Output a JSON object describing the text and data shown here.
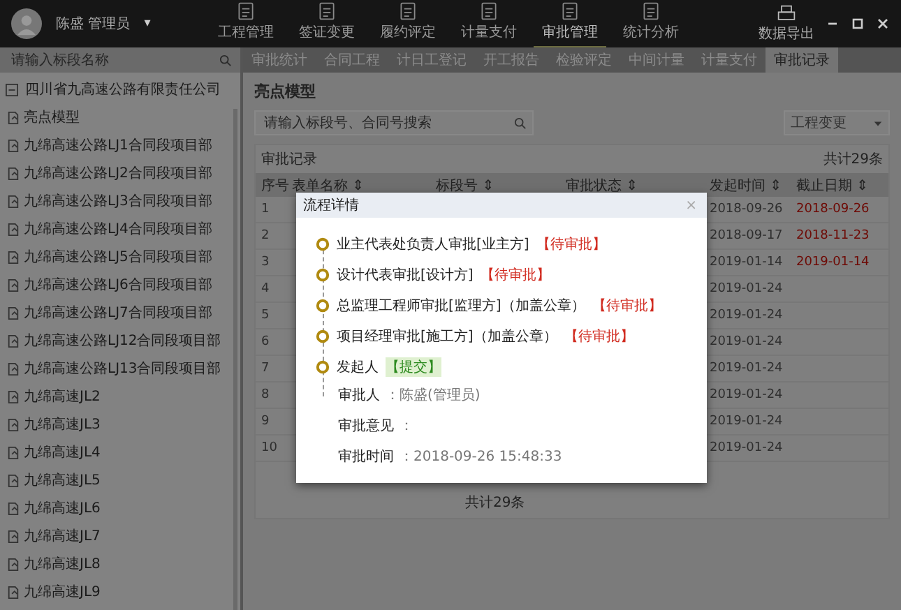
{
  "top_bar": {
    "user": "陈盛  管理员",
    "caret": "▾",
    "nav": [
      {
        "label": "工程管理",
        "selected": false
      },
      {
        "label": "签证变更",
        "selected": false
      },
      {
        "label": "履约评定",
        "selected": false
      },
      {
        "label": "计量支付",
        "selected": false
      },
      {
        "label": "审批管理",
        "selected": true
      },
      {
        "label": "统计分析",
        "selected": false
      }
    ],
    "export": "数据导出"
  },
  "sidebar": {
    "search": {
      "placeholder": "请输入标段名称"
    },
    "tree": [
      {
        "label": "四川省九高速公路有限责任公司",
        "expanded": true,
        "children": [
          {
            "label": "亮点模型"
          },
          {
            "label": "九绵高速公路LJ1合同段项目部"
          },
          {
            "label": "九绵高速公路LJ2合同段项目部"
          },
          {
            "label": "九绵高速公路LJ3合同段项目部"
          },
          {
            "label": "九绵高速公路LJ4合同段项目部"
          },
          {
            "label": "九绵高速公路LJ5合同段项目部"
          },
          {
            "label": "九绵高速公路LJ6合同段项目部"
          },
          {
            "label": "九绵高速公路LJ7合同段项目部"
          },
          {
            "label": "九绵高速公路LJ12合同段项目部"
          },
          {
            "label": "九绵高速公路LJ13合同段项目部"
          },
          {
            "label": "九绵高速JL2"
          },
          {
            "label": "九绵高速JL3"
          },
          {
            "label": "九绵高速JL4"
          },
          {
            "label": "九绵高速JL5"
          },
          {
            "label": "九绵高速JL6"
          },
          {
            "label": "九绵高速JL7"
          },
          {
            "label": "九绵高速JL8"
          },
          {
            "label": "九绵高速JL9"
          }
        ]
      }
    ]
  },
  "tabs": [
    {
      "label": "审批统计",
      "selected": false
    },
    {
      "label": "合同工程",
      "selected": false
    },
    {
      "label": "计日工登记",
      "selected": false
    },
    {
      "label": "开工报告",
      "selected": false
    },
    {
      "label": "检验评定",
      "selected": false
    },
    {
      "label": "中间计量",
      "selected": false
    },
    {
      "label": "计量支付",
      "selected": false
    },
    {
      "label": "审批记录",
      "selected": true
    }
  ],
  "content": {
    "title": "亮点模型",
    "search": {
      "placeholder": "请输入标段号、合同号搜索"
    },
    "filter": {
      "value": "工程变更"
    },
    "table": {
      "title": "审批记录",
      "total": "共计29条",
      "columns": [
        "序号",
        "表单名称 ⇕",
        "标段号 ⇕",
        "审批状态 ⇕",
        "发起时间 ⇕",
        "截止日期 ⇕"
      ],
      "rows": [
        {
          "seq": "1",
          "start_time": "2018-09-26",
          "deadline": "2018-09-26",
          "overdue": true
        },
        {
          "seq": "2",
          "start_time": "2018-09-17",
          "deadline": "2018-11-23",
          "overdue": true
        },
        {
          "seq": "3",
          "start_time": "2019-01-14",
          "deadline": "2019-01-14",
          "overdue": true
        },
        {
          "seq": "4",
          "start_time": "2019-01-24",
          "deadline": "",
          "overdue": false
        },
        {
          "seq": "5",
          "start_time": "2019-01-24",
          "deadline": "",
          "overdue": false
        },
        {
          "seq": "6",
          "start_time": "2019-01-24",
          "deadline": "",
          "overdue": false
        },
        {
          "seq": "7",
          "start_time": "2019-01-24",
          "deadline": "",
          "overdue": false
        },
        {
          "seq": "8",
          "start_time": "2019-01-24",
          "deadline": "",
          "overdue": false
        },
        {
          "seq": "9",
          "start_time": "2019-01-24",
          "deadline": "",
          "overdue": false
        },
        {
          "seq": "10",
          "start_time": "2019-01-24",
          "deadline": "",
          "overdue": false
        }
      ],
      "footer": "共计29条"
    }
  },
  "dialog": {
    "title": "流程详情",
    "close": "×",
    "steps": [
      {
        "label": "业主代表处负责人审批[业主方]",
        "status": "【待审批】",
        "kind": "pending"
      },
      {
        "label": "设计代表审批[设计方]",
        "status": "【待审批】",
        "kind": "pending"
      },
      {
        "label": "总监理工程师审批[监理方]（加盖公章）",
        "status": "【待审批】",
        "kind": "pending"
      },
      {
        "label": "项目经理审批[施工方]（加盖公章）",
        "status": "【待审批】",
        "kind": "pending"
      },
      {
        "label": "发起人",
        "status": "【提交】",
        "kind": "done"
      }
    ],
    "details": [
      {
        "label": "审批人",
        "value": "：陈盛(管理员)"
      },
      {
        "label": "审批意见",
        "value": "："
      },
      {
        "label": "审批时间",
        "value": "：2018-09-26 15:48:33"
      }
    ]
  }
}
